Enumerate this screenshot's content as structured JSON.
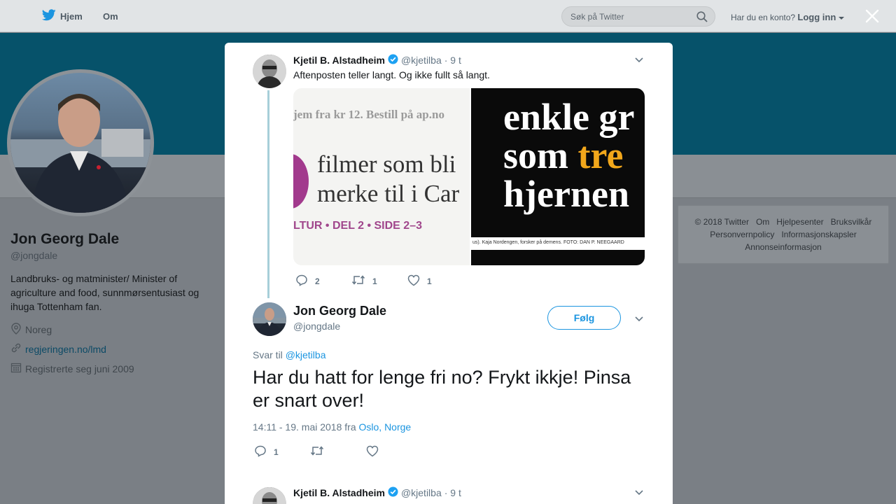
{
  "topnav": {
    "home_label": "Hjem",
    "about_label": "Om",
    "search_placeholder": "Søk på Twitter",
    "account_question": "Har du en konto?",
    "login_label": "Logg inn"
  },
  "profile": {
    "name": "Jon Georg Dale",
    "handle": "@jongdale",
    "bio": "Landbruks- og matminister/ Minister of agriculture and food, sunnmørsentusiast og ihuga Tottenham fan.",
    "location": "Noreg",
    "website": "regjeringen.no/lmd",
    "joined": "Registrerte seg juni 2009"
  },
  "footer": {
    "links": [
      "© 2018 Twitter",
      "Om",
      "Hjelpesenter",
      "Bruksvilkår",
      "Personvernpolicy",
      "Informasjonskapsler",
      "Annonseinformasjon"
    ]
  },
  "parent_tweet": {
    "name": "Kjetil B. Alstadheim",
    "handle": "@kjetilba",
    "time": "· 9 t",
    "text": "Aftenposten teller langt. Og ikke fullt så langt.",
    "media_left": {
      "line1": "jem fra kr 12. Bestill på ap.no",
      "line2a": "filmer som bli",
      "line2b": "merke til i Car",
      "line3": "LTUR • DEL 2 • SIDE 2–3"
    },
    "media_right": {
      "line1": "enkle gr",
      "line2a": "som",
      "line2b": "tre",
      "line3": "hjernen",
      "caption": "us). Kaja Nordengen, forsker på demens.  FOTO: DAN P. NEEGAARD"
    },
    "replies": "2",
    "retweets": "1",
    "likes": "1"
  },
  "main_tweet": {
    "name": "Jon Georg Dale",
    "handle": "@jongdale",
    "follow_label": "Følg",
    "reply_prefix": "Svar til",
    "reply_handle": "@kjetilba",
    "text": "Har du hatt for lenge fri no? Frykt ikkje! Pinsa er snart over!",
    "timestamp": "14:11 - 19. mai 2018 fra",
    "location": "Oslo, Norge",
    "replies": "1"
  },
  "next_tweet": {
    "name": "Kjetil B. Alstadheim",
    "handle": "@kjetilba",
    "time": "· 9 t"
  },
  "colors": {
    "accent": "#1b95e0",
    "verified": "#1da1f2",
    "banner": "#06526a",
    "overlay_bg": "#7a7f85"
  }
}
